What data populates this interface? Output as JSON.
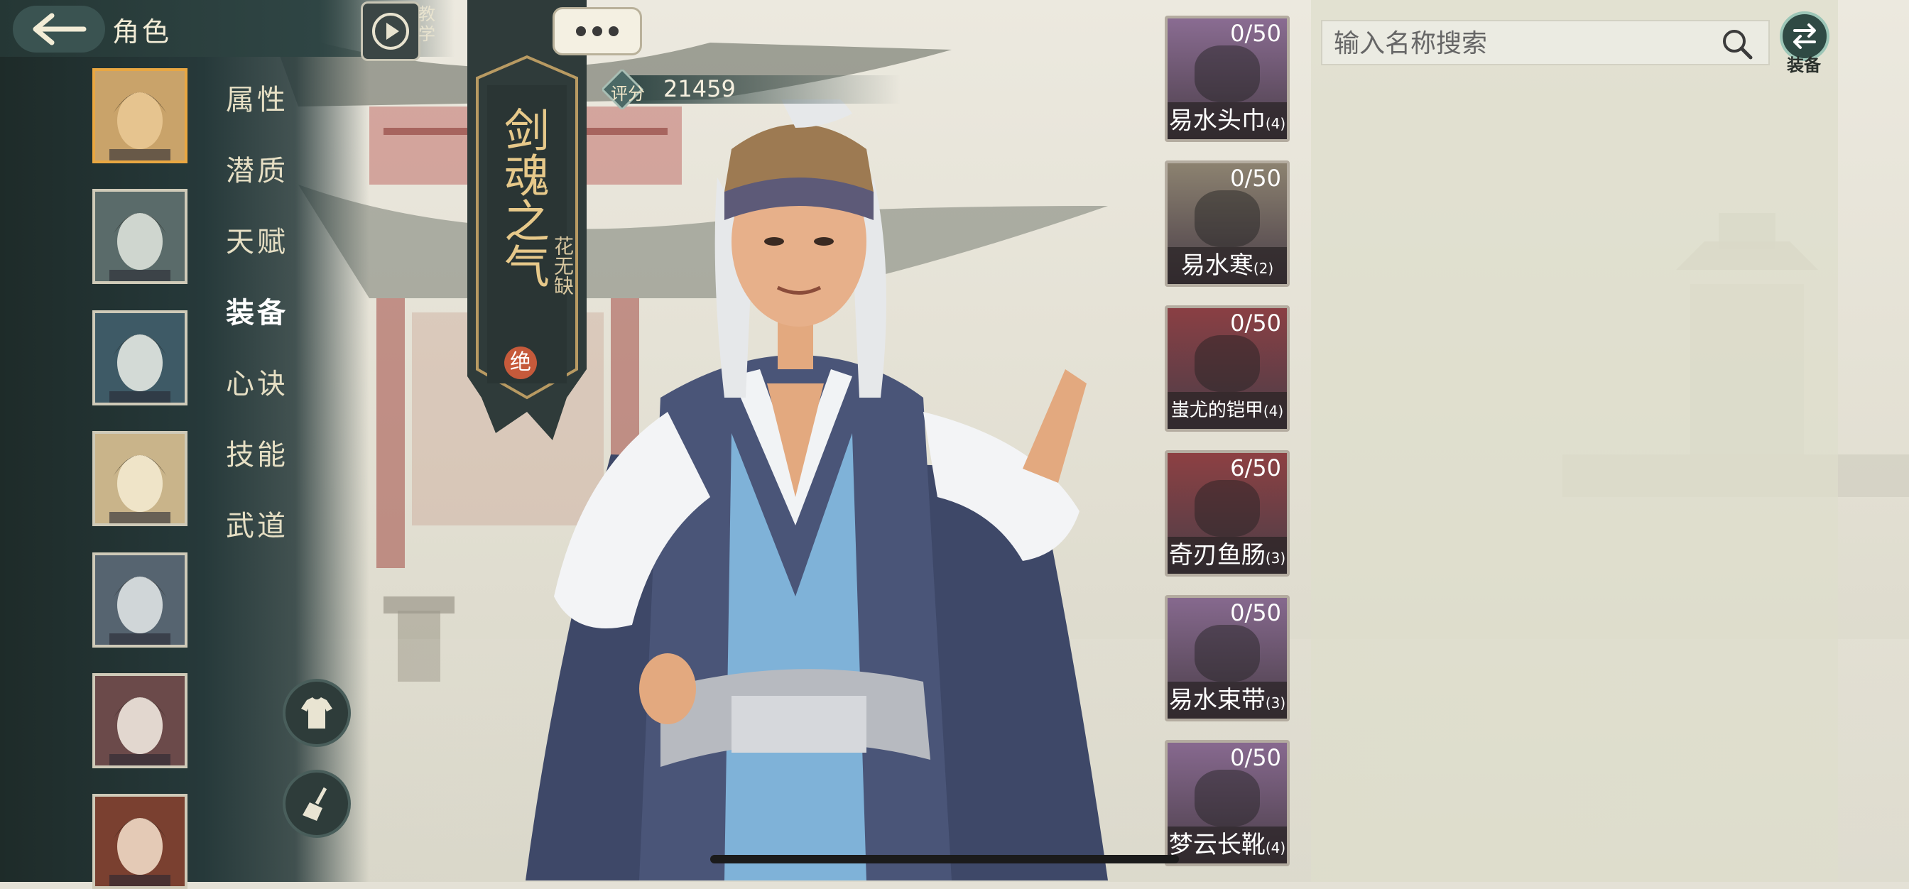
{
  "header": {
    "title": "角色",
    "tutorial_label": "教学"
  },
  "characters": [
    {
      "name": "portrait-1",
      "selected": true
    },
    {
      "name": "portrait-2",
      "selected": false
    },
    {
      "name": "portrait-3",
      "selected": false
    },
    {
      "name": "portrait-4",
      "selected": false
    },
    {
      "name": "portrait-5",
      "selected": false
    },
    {
      "name": "portrait-6",
      "selected": false
    },
    {
      "name": "portrait-7",
      "selected": false
    }
  ],
  "menu": {
    "items": [
      "属性",
      "潜质",
      "天赋",
      "装备",
      "心诀",
      "技能",
      "武道"
    ],
    "active_index": 3
  },
  "banner": {
    "title": "剑魂之气",
    "name": "花无缺",
    "rank": "绝"
  },
  "score": {
    "label": "评分",
    "value": "21459"
  },
  "equipment": [
    {
      "count": "0/50",
      "name": "易水头巾",
      "level": "(4)",
      "color": "#8a6c92",
      "icon": "hat-icon"
    },
    {
      "count": "0/50",
      "name": "易水寒",
      "level": "(2)",
      "color": "#8c8270",
      "icon": "ring-icon"
    },
    {
      "count": "0/50",
      "name": "蚩尤的铠甲",
      "level": "(4)",
      "color": "#8a3f44",
      "icon": "armor-icon"
    },
    {
      "count": "6/50",
      "name": "奇刃鱼肠",
      "level": "(3)",
      "color": "#8d4043",
      "icon": "sword-icon"
    },
    {
      "count": "0/50",
      "name": "易水束带",
      "level": "(3)",
      "color": "#86698e",
      "icon": "belt-icon"
    },
    {
      "count": "0/50",
      "name": "梦云长靴",
      "level": "(4)",
      "color": "#87698f",
      "icon": "boots-icon"
    }
  ],
  "search": {
    "placeholder": "输入名称搜索"
  },
  "equip_toggle": {
    "label": "装备"
  }
}
